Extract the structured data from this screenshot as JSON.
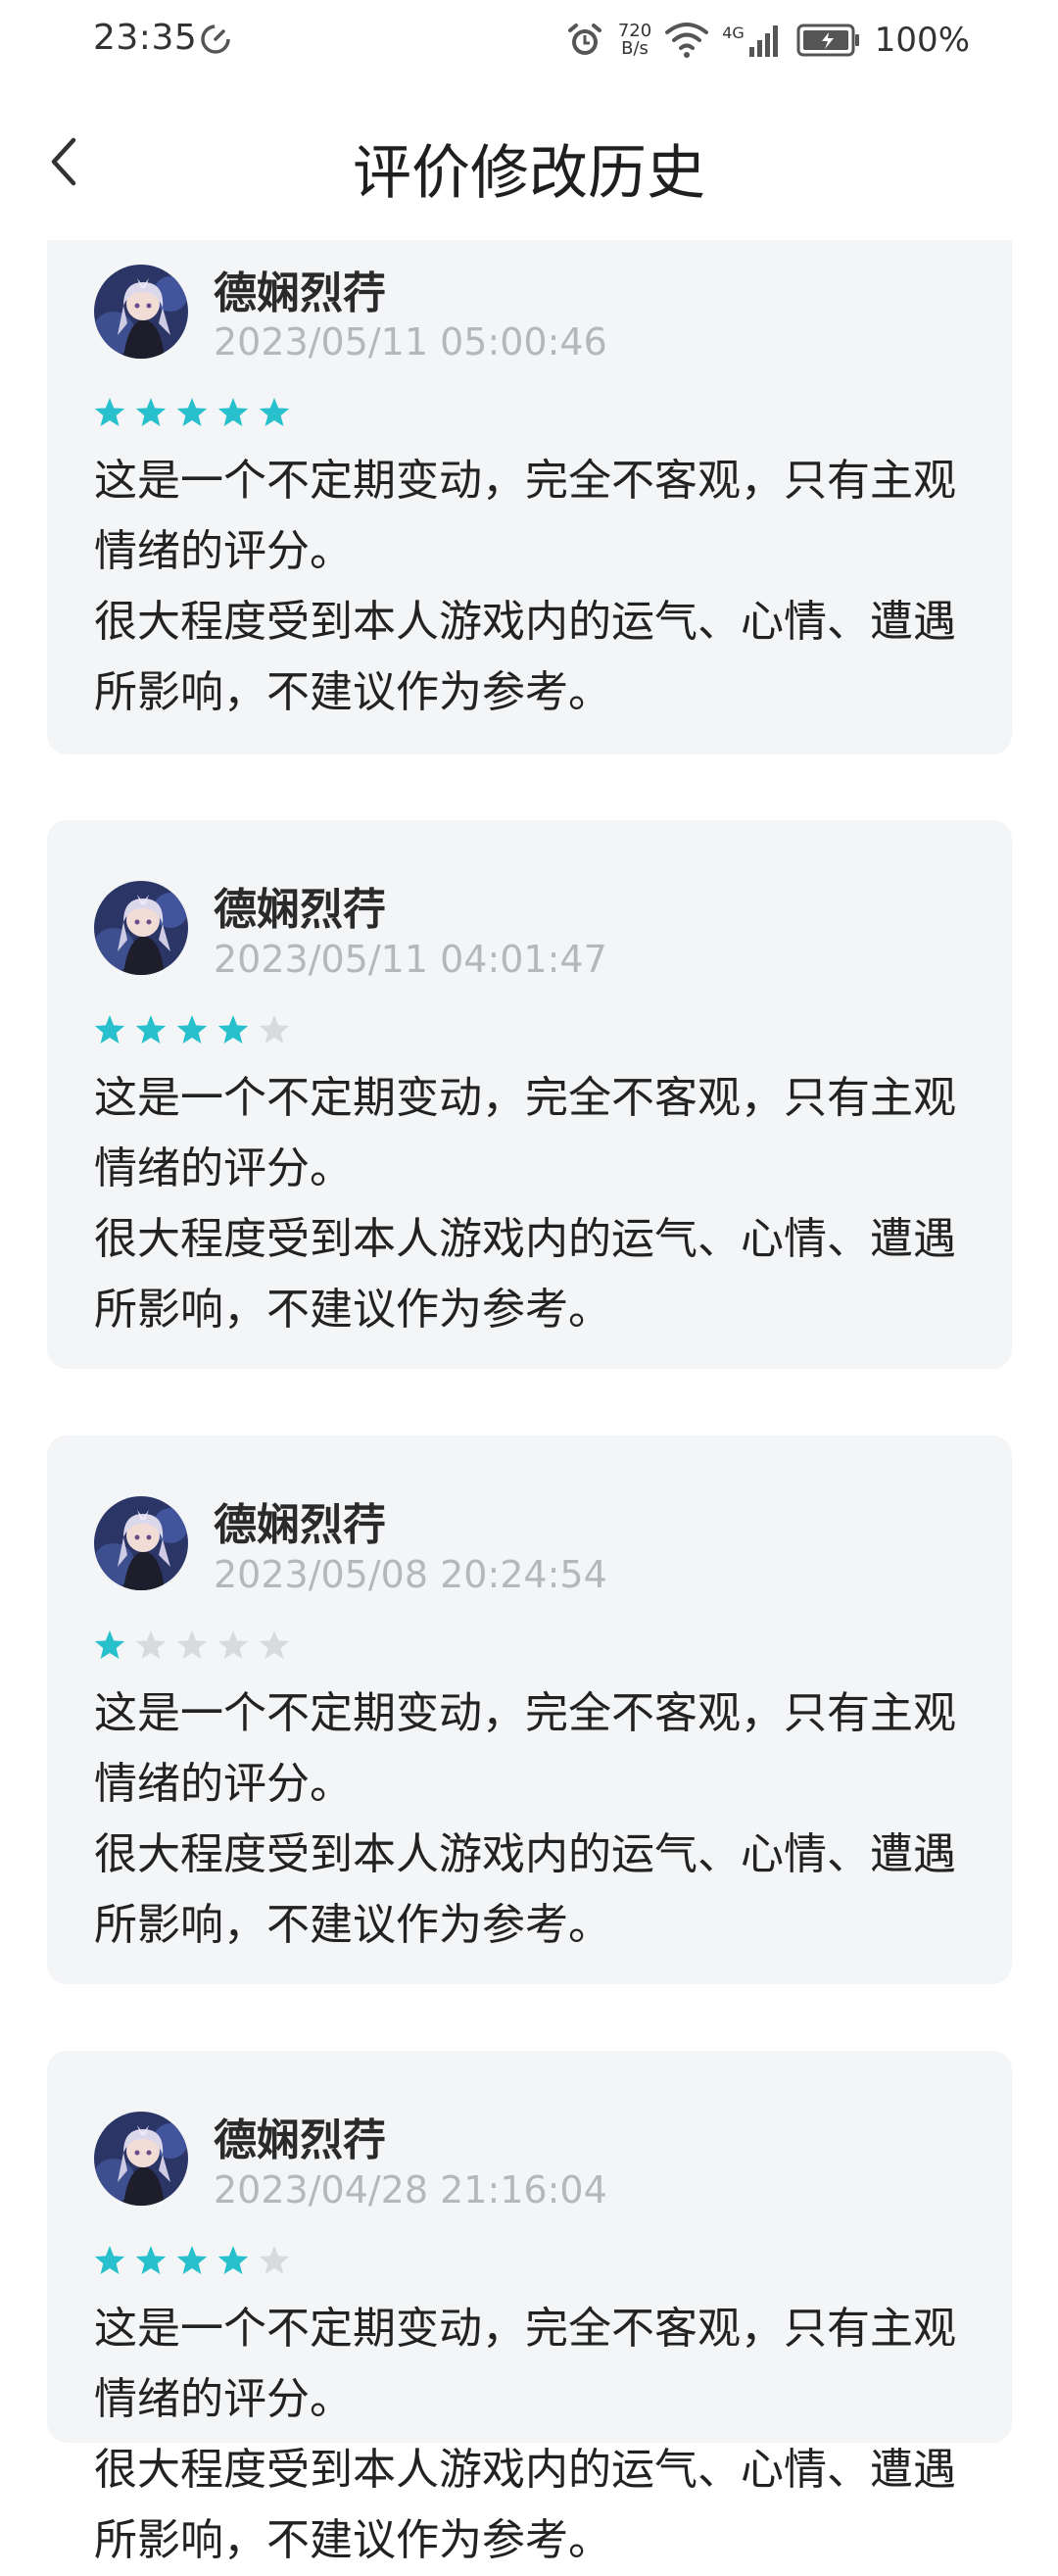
{
  "status_bar": {
    "time": "23:35",
    "net_speed_value": "720",
    "net_speed_unit": "B/s",
    "network_type": "4G",
    "battery": "100%"
  },
  "header": {
    "title": "评价修改历史"
  },
  "colors": {
    "star_active": "#27c0cc",
    "star_inactive": "#d9dadd",
    "card_background": "#f4f5f7",
    "timestamp": "#b5b7bb"
  },
  "reviews": [
    {
      "user": "德娴烈荇",
      "time": "2023/05/11 05:00:46",
      "rating": 5,
      "text_lines": [
        "这是一个不定期变动，完全不客观，只有主观情绪的评分。",
        "很大程度受到本人游戏内的运气、心情、遭遇所影响，不建议作为参考。"
      ]
    },
    {
      "user": "德娴烈荇",
      "time": "2023/05/11 04:01:47",
      "rating": 4,
      "text_lines": [
        "这是一个不定期变动，完全不客观，只有主观情绪的评分。",
        "很大程度受到本人游戏内的运气、心情、遭遇所影响，不建议作为参考。"
      ]
    },
    {
      "user": "德娴烈荇",
      "time": "2023/05/08 20:24:54",
      "rating": 1,
      "text_lines": [
        "这是一个不定期变动，完全不客观，只有主观情绪的评分。",
        "很大程度受到本人游戏内的运气、心情、遭遇所影响，不建议作为参考。"
      ]
    },
    {
      "user": "德娴烈荇",
      "time": "2023/04/28 21:16:04",
      "rating": 4,
      "text_lines": [
        "这是一个不定期变动，完全不客观，只有主观情绪的评分。",
        "很大程度受到本人游戏内的运气、心情、遭遇所影响，不建议作为参考。"
      ]
    }
  ]
}
